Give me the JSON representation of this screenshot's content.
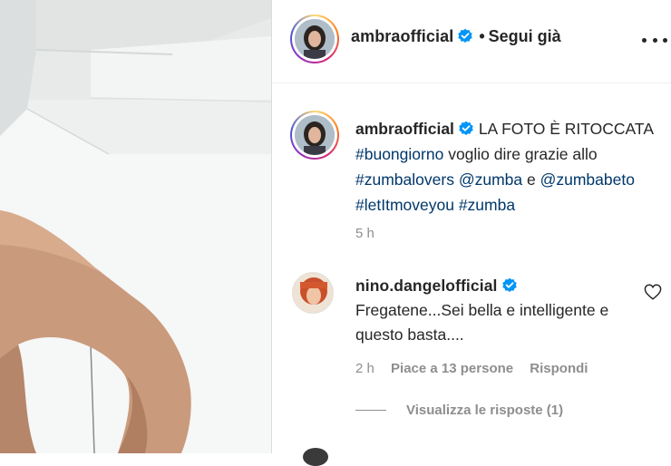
{
  "header": {
    "username": "ambraofficial",
    "separator": "•",
    "follow_label": "Segui già"
  },
  "caption": {
    "username": "ambraofficial",
    "text_plain_1": "LA FOTO È RITOCCATA",
    "tag_1": "#buongiorno",
    "text_plain_2": "voglio dire grazie allo",
    "tag_2": "#zumbalovers",
    "mention_1": "@zumba",
    "text_plain_3": "e",
    "mention_2": "@zumbabeto",
    "tag_3": "#letItmoveyou",
    "tag_4": "#zumba",
    "time": "5 h"
  },
  "comment": {
    "username": "nino.dangelofficial",
    "text": "Fregatene...Sei bella e intelligente e questo basta....",
    "time": "2 h",
    "likes_label": "Piace a 13 persone",
    "reply_label": "Rispondi",
    "view_replies_label": "Visualizza le risposte (1)"
  },
  "icons": {
    "verified": "verified-badge-icon",
    "more": "more-options-icon",
    "like": "heart-icon"
  },
  "colors": {
    "verified_blue": "#0095f6",
    "hashtag": "#00376b",
    "muted": "#8e8e8e"
  }
}
